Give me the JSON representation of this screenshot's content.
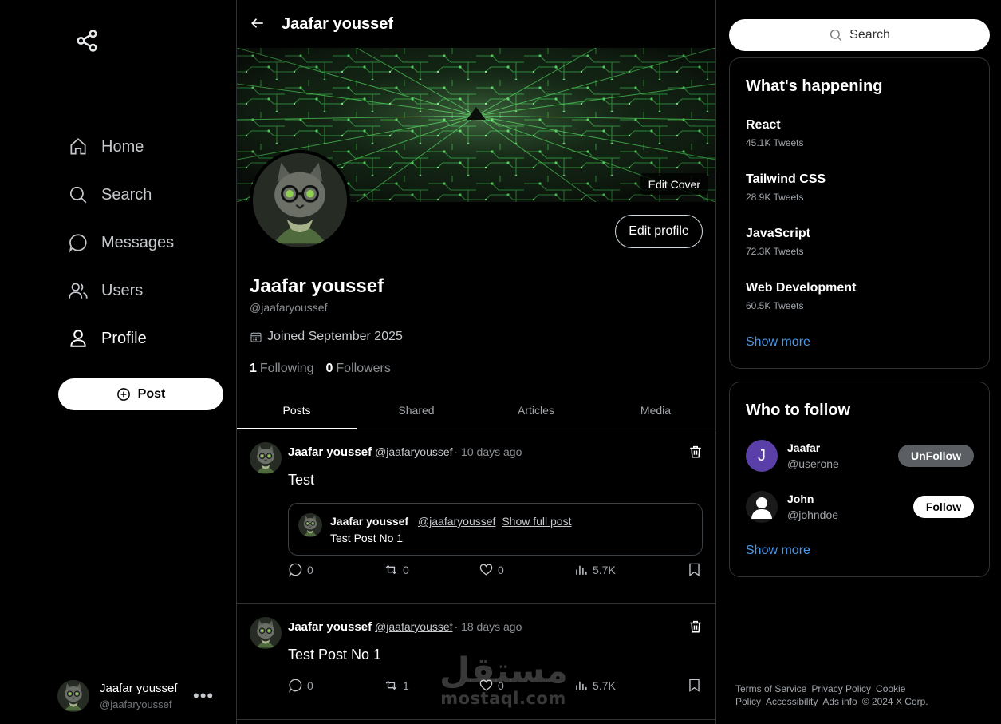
{
  "sidebar": {
    "logo_icon": "share-icon",
    "nav": [
      {
        "label": "Home",
        "icon": "home-icon"
      },
      {
        "label": "Search",
        "icon": "search-icon"
      },
      {
        "label": "Messages",
        "icon": "message-icon"
      },
      {
        "label": "Users",
        "icon": "users-icon"
      },
      {
        "label": "Profile",
        "icon": "user-icon"
      }
    ],
    "post_button": "Post",
    "account": {
      "name": "Jaafar youssef",
      "handle": "@jaafaryoussef",
      "menu": "•••"
    }
  },
  "header": {
    "title": "Jaafar youssef"
  },
  "profile": {
    "edit_cover": "Edit Cover",
    "edit_profile": "Edit profile",
    "name": "Jaafar youssef",
    "handle": "@jaafaryoussef",
    "joined": "Joined September 2025",
    "following_count": "1",
    "following_label": "Following",
    "followers_count": "0",
    "followers_label": "Followers"
  },
  "tabs": [
    "Posts",
    "Shared",
    "Articles",
    "Media"
  ],
  "posts": [
    {
      "name": "Jaafar youssef",
      "handle": "@jaafaryoussef",
      "time": "· 10 days ago",
      "text": "Test",
      "quote": {
        "name": "Jaafar youssef",
        "handle": "@jaafaryoussef",
        "show_full": "Show full post",
        "text": "Test Post No 1"
      },
      "stats": {
        "comments": "0",
        "reposts": "0",
        "likes": "0",
        "views": "5.7K"
      }
    },
    {
      "name": "Jaafar youssef",
      "handle": "@jaafaryoussef",
      "time": "· 18 days ago",
      "text": "Test Post No 1",
      "stats": {
        "comments": "0",
        "reposts": "1",
        "likes": "0",
        "views": "5.7K"
      }
    }
  ],
  "watermark": {
    "arabic": "مستقل",
    "latin": "mostaql.com"
  },
  "right": {
    "search_label": "Search",
    "trends_title": "What's happening",
    "trends": [
      {
        "name": "React",
        "count": "45.1K Tweets"
      },
      {
        "name": "Tailwind CSS",
        "count": "28.9K Tweets"
      },
      {
        "name": "JavaScript",
        "count": "72.3K Tweets"
      },
      {
        "name": "Web Development",
        "count": "60.5K Tweets"
      }
    ],
    "trends_show_more": "Show more",
    "wtf_title": "Who to follow",
    "wtf": [
      {
        "initial": "J",
        "name": "Jaafar",
        "handle": "@userone",
        "button": "UnFollow",
        "avatar_color": "#5b3fa8"
      },
      {
        "initial": "",
        "name": "John",
        "handle": "@johndoe",
        "button": "Follow",
        "avatar_color": "#1a1a1a"
      }
    ],
    "wtf_show_more": "Show more",
    "footer": [
      "Terms of Service",
      "Privacy Policy",
      "Cookie Policy",
      "Accessibility",
      "Ads info",
      "© 2024 X Corp."
    ]
  },
  "colors": {
    "accent_link": "#4a99e9",
    "background": "#000000",
    "border": "#2f3336"
  }
}
